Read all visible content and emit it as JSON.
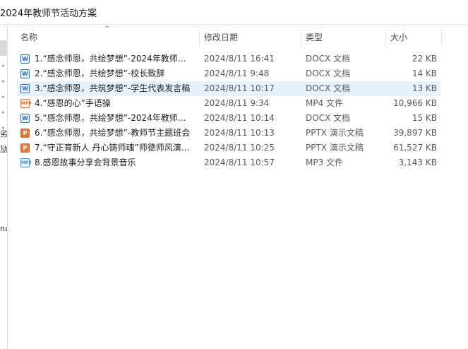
{
  "window": {
    "title": "2024年教师节活动方案"
  },
  "left_pane": {
    "fragments": [
      "劣",
      "劢",
      "na"
    ]
  },
  "columns": {
    "name": "名称",
    "date": "修改日期",
    "type": "类型",
    "size": "大小",
    "sort_arrow": "^"
  },
  "files": [
    {
      "icon": "docx",
      "icon_glyph": "W",
      "name": "1.“感念师恩，共绘梦想”-2024年教师节...",
      "date": "2024/8/11 16:41",
      "type": "DOCX 文档",
      "size": "22 KB"
    },
    {
      "icon": "docx",
      "icon_glyph": "W",
      "name": "2.“感念师恩，共绘梦想”-校长致辞",
      "date": "2024/8/11 9:48",
      "type": "DOCX 文档",
      "size": "14 KB"
    },
    {
      "icon": "docx",
      "icon_glyph": "W",
      "name": "3.“感念师恩，共筑梦想”-学生代表发言稿",
      "date": "2024/8/11 10:17",
      "type": "DOCX 文档",
      "size": "13 KB"
    },
    {
      "icon": "mp4",
      "icon_glyph": "MP4",
      "name": "4.“感恩的心”手语操",
      "date": "2024/8/11 9:34",
      "type": "MP4 文件",
      "size": "10,966 KB"
    },
    {
      "icon": "docx",
      "icon_glyph": "W",
      "name": "5.“感念师恩，共绘梦想”-2024年教师节...",
      "date": "2024/8/11 10:14",
      "type": "DOCX 文档",
      "size": "15 KB"
    },
    {
      "icon": "pptx",
      "icon_glyph": "P",
      "name": "6.“感念师恩，共绘梦想”-教师节主题班会",
      "date": "2024/8/11 10:13",
      "type": "PPTX 演示文稿",
      "size": "39,897 KB"
    },
    {
      "icon": "pptx",
      "icon_glyph": "P",
      "name": "7.“守正育新人 丹心铸师魂”师德师风演讲...",
      "date": "2024/8/11 10:25",
      "type": "PPTX 演示文稿",
      "size": "61,527 KB"
    },
    {
      "icon": "mp3",
      "icon_glyph": "MP3",
      "name": "8.感恩故事分享会背景音乐",
      "date": "2024/8/11 10:57",
      "type": "MP3 文件",
      "size": "3,143 KB"
    }
  ]
}
